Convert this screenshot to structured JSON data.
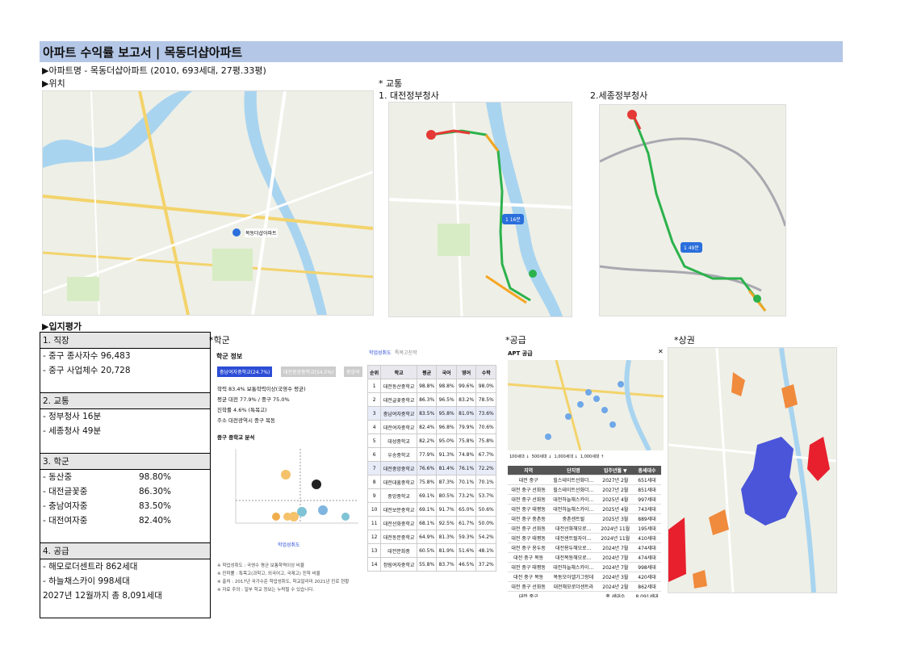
{
  "header": {
    "title": "아파트 수익률 보고서  |  목동더샵아파트",
    "apt_line": "▶아파트명 - 목동더샵아파트 (2010, 693세대, 27평.33평)",
    "location_label": "▶위치",
    "traffic_label": "* 교통",
    "gov1_label": "1. 대전정부청사",
    "gov2_label": "2.세종정부청사"
  },
  "maps": {
    "location_marker": "목동더샵아파트",
    "route1_time": "1 16분",
    "route2_time": "1 49분"
  },
  "evaluation": {
    "section_label": "▶입지평가",
    "groups": [
      {
        "header": "1. 직장",
        "rows": [
          {
            "label": "- 중구 종사자수 96,483",
            "value": ""
          },
          {
            "label": "- 중구 사업체수 20,728",
            "value": ""
          }
        ]
      },
      {
        "header": "2. 교통",
        "rows": [
          {
            "label": "- 정부청사 16분",
            "value": ""
          },
          {
            "label": "- 세종청사 49분",
            "value": ""
          }
        ]
      },
      {
        "header": "3. 학군",
        "rows": [
          {
            "label": "- 동산중",
            "value": "98.80%"
          },
          {
            "label": "- 대전글꽃중",
            "value": "86.30%"
          },
          {
            "label": "- 충남여자중",
            "value": "83.50%"
          },
          {
            "label": "- 대전여자중",
            "value": "82.40%"
          }
        ]
      },
      {
        "header": "4. 공급",
        "rows": [
          {
            "label": "- 해모로더센트라 862세대",
            "value": ""
          },
          {
            "label": "- 하늘채스카이 998세대",
            "value": ""
          },
          {
            "label": "2027년 12월까지 총 8,091세대",
            "value": ""
          }
        ]
      }
    ]
  },
  "school": {
    "label": "*학군",
    "panel_title": "학군 정보",
    "tabs": [
      "충남여자중학교(24.7%)",
      "대전중앙중학교(54.5%)",
      "중앙여"
    ],
    "lines": [
      "학력 83.4% 보통학력이상(국영수 평균)",
      "평균 대전 77.9% / 중구 75.0%",
      "진학률 4.6% (특목고)",
      "주소 대전광역시 중구 목동"
    ],
    "chart_title": "중구 중학교 분석",
    "chart_xlabel": "학업성취도",
    "notes": [
      "※ 학업성취도 : 국영수 평균 보통학력이상 비율",
      "※ 진학률 : 특목고(과학고, 외국어고, 국제고) 진학 비율",
      "※ 출처 : 2017년 국가수준 학업성취도, 학교알리미 2021년 진로 현황",
      "※ 자료 주의 : 일부 학교 정보는 누락될 수 있습니다."
    ],
    "table_tabs": [
      "학업성취도",
      "특목고진학"
    ],
    "table_headers": [
      "순위",
      "학교",
      "평균",
      "국어",
      "영어",
      "수학"
    ],
    "table_rows": [
      [
        "1",
        "대전동산중학교",
        "98.8%",
        "98.8%",
        "99.6%",
        "98.0%"
      ],
      [
        "2",
        "대전글꽃중학교",
        "86.3%",
        "96.5%",
        "83.2%",
        "78.5%"
      ],
      [
        "3",
        "충남여자중학교",
        "83.5%",
        "95.8%",
        "81.0%",
        "73.6%"
      ],
      [
        "4",
        "대전여자중학교",
        "82.4%",
        "96.8%",
        "79.9%",
        "70.6%"
      ],
      [
        "5",
        "대성중학교",
        "82.2%",
        "95.0%",
        "75.8%",
        "75.8%"
      ],
      [
        "6",
        "우송중학교",
        "77.9%",
        "91.3%",
        "74.8%",
        "67.7%"
      ],
      [
        "7",
        "대전중앙중학교",
        "76.6%",
        "81.4%",
        "76.1%",
        "72.2%"
      ],
      [
        "8",
        "대전대흥중학교",
        "75.8%",
        "87.3%",
        "70.1%",
        "70.1%"
      ],
      [
        "9",
        "중앙중학교",
        "69.1%",
        "80.5%",
        "73.2%",
        "53.7%"
      ],
      [
        "10",
        "대전보문중학교",
        "69.1%",
        "91.7%",
        "65.0%",
        "50.6%"
      ],
      [
        "11",
        "대전선화중학교",
        "68.1%",
        "92.5%",
        "61.7%",
        "50.0%"
      ],
      [
        "12",
        "대전동문중학교",
        "64.9%",
        "81.3%",
        "59.3%",
        "54.2%"
      ],
      [
        "13",
        "대전문화중",
        "60.5%",
        "81.9%",
        "51.6%",
        "48.1%"
      ],
      [
        "14",
        "정림여자중학교",
        "55.8%",
        "83.7%",
        "46.5%",
        "37.2%"
      ]
    ]
  },
  "supply": {
    "label": "*공급",
    "panel_title": "APT 공급",
    "legend": [
      "100세대 ↓",
      "500세대 ↓",
      "1,000세대 ↓",
      "1,000세대 ↑"
    ],
    "table_headers": [
      "지역",
      "단지명",
      "입주년월 ▼",
      "총세대수"
    ],
    "table_rows": [
      [
        "대전 중구",
        "힐스테이트선화더…",
        "2027년 2월",
        "651세대"
      ],
      [
        "대전 중구 선화동",
        "힐스테이트선화더…",
        "2027년 2월",
        "851세대"
      ],
      [
        "대전 중구 선화동",
        "대전하늘채스카이…",
        "2025년 4월",
        "997세대"
      ],
      [
        "대전 중구 태평동",
        "대전하늘채스카이…",
        "2025년 4월",
        "743세대"
      ],
      [
        "대전 중구 중촌동",
        "중촌센트럴",
        "2025년 3월",
        "889세대"
      ],
      [
        "대전 중구 선화동",
        "대전선화해모로…",
        "2024년 11월",
        "195세대"
      ],
      [
        "대전 중구 태평동",
        "대전센트럴자이…",
        "2024년 11월",
        "410세대"
      ],
      [
        "대전 중구 용두동",
        "대전용두해모로…",
        "2024년 7월",
        "474세대"
      ],
      [
        "대전 중구 목동",
        "대전목동해모로…",
        "2024년 7월",
        "474세대"
      ],
      [
        "대전 중구 태평동",
        "대전하늘채스카이…",
        "2024년 7월",
        "998세대"
      ],
      [
        "대전 중구 목동",
        "목동모아엘가그랑데",
        "2024년 3월",
        "420세대"
      ],
      [
        "대전 중구 선화동",
        "대전해모로더센트라",
        "2024년 2월",
        "862세대"
      ],
      [
        "대전 중구",
        "",
        "총 세대수",
        "8,091세대"
      ]
    ]
  },
  "commerce": {
    "label": "*상권"
  },
  "colors": {
    "title_bar": "#b4c7e7",
    "route_green": "#2bb24c",
    "route_red": "#e53935",
    "commerce_blue": "#4a55d9",
    "commerce_red": "#e8202e"
  }
}
